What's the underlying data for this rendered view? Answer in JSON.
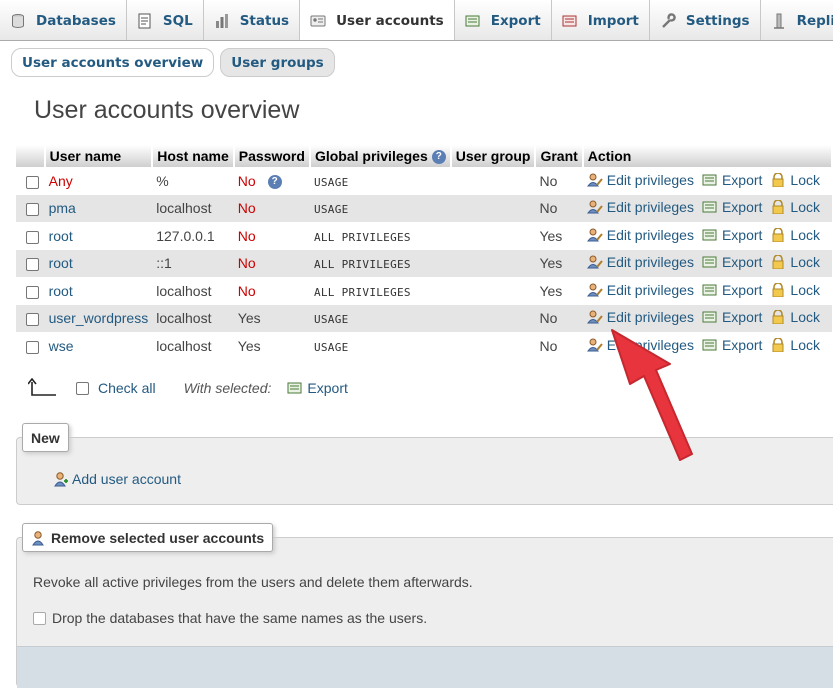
{
  "tabs": [
    {
      "label": "Databases",
      "icon": "database-icon",
      "active": false
    },
    {
      "label": "SQL",
      "icon": "sql-icon",
      "active": false
    },
    {
      "label": "Status",
      "icon": "status-icon",
      "active": false
    },
    {
      "label": "User accounts",
      "icon": "user-accounts-icon",
      "active": true
    },
    {
      "label": "Export",
      "icon": "export-icon",
      "active": false
    },
    {
      "label": "Import",
      "icon": "import-icon",
      "active": false
    },
    {
      "label": "Settings",
      "icon": "wrench-icon",
      "active": false
    },
    {
      "label": "Replication",
      "icon": "replication-icon",
      "active": false
    }
  ],
  "subtabs": {
    "overview": "User accounts overview",
    "groups": "User groups"
  },
  "title": "User accounts overview",
  "table": {
    "headers": {
      "user": "User name",
      "host": "Host name",
      "password": "Password",
      "global": "Global privileges",
      "group": "User group",
      "grant": "Grant",
      "action": "Action"
    },
    "rows": [
      {
        "user": "Any",
        "host": "%",
        "password": "No",
        "priv": "USAGE",
        "group": "",
        "grant": "No"
      },
      {
        "user": "pma",
        "host": "localhost",
        "password": "No",
        "priv": "USAGE",
        "group": "",
        "grant": "No"
      },
      {
        "user": "root",
        "host": "127.0.0.1",
        "password": "No",
        "priv": "ALL PRIVILEGES",
        "group": "",
        "grant": "Yes"
      },
      {
        "user": "root",
        "host": "::1",
        "password": "No",
        "priv": "ALL PRIVILEGES",
        "group": "",
        "grant": "Yes"
      },
      {
        "user": "root",
        "host": "localhost",
        "password": "No",
        "priv": "ALL PRIVILEGES",
        "group": "",
        "grant": "Yes"
      },
      {
        "user": "user_wordpress",
        "host": "localhost",
        "password": "Yes",
        "priv": "USAGE",
        "group": "",
        "grant": "No"
      },
      {
        "user": "wse",
        "host": "localhost",
        "password": "Yes",
        "priv": "USAGE",
        "group": "",
        "grant": "No"
      }
    ],
    "actions": {
      "edit": "Edit privileges",
      "export": "Export",
      "lock": "Lock"
    }
  },
  "bulk": {
    "check_all": "Check all",
    "with_selected": "With selected:",
    "export": "Export"
  },
  "new_section": {
    "legend": "New",
    "add_user": "Add user account"
  },
  "remove_section": {
    "legend": "Remove selected user accounts",
    "description": "Revoke all active privileges from the users and delete them afterwards.",
    "drop_label": "Drop the databases that have the same names as the users."
  },
  "colors": {
    "link": "#235a81",
    "no_password": "#cc0000",
    "annotation_arrow": "#e8343c"
  }
}
